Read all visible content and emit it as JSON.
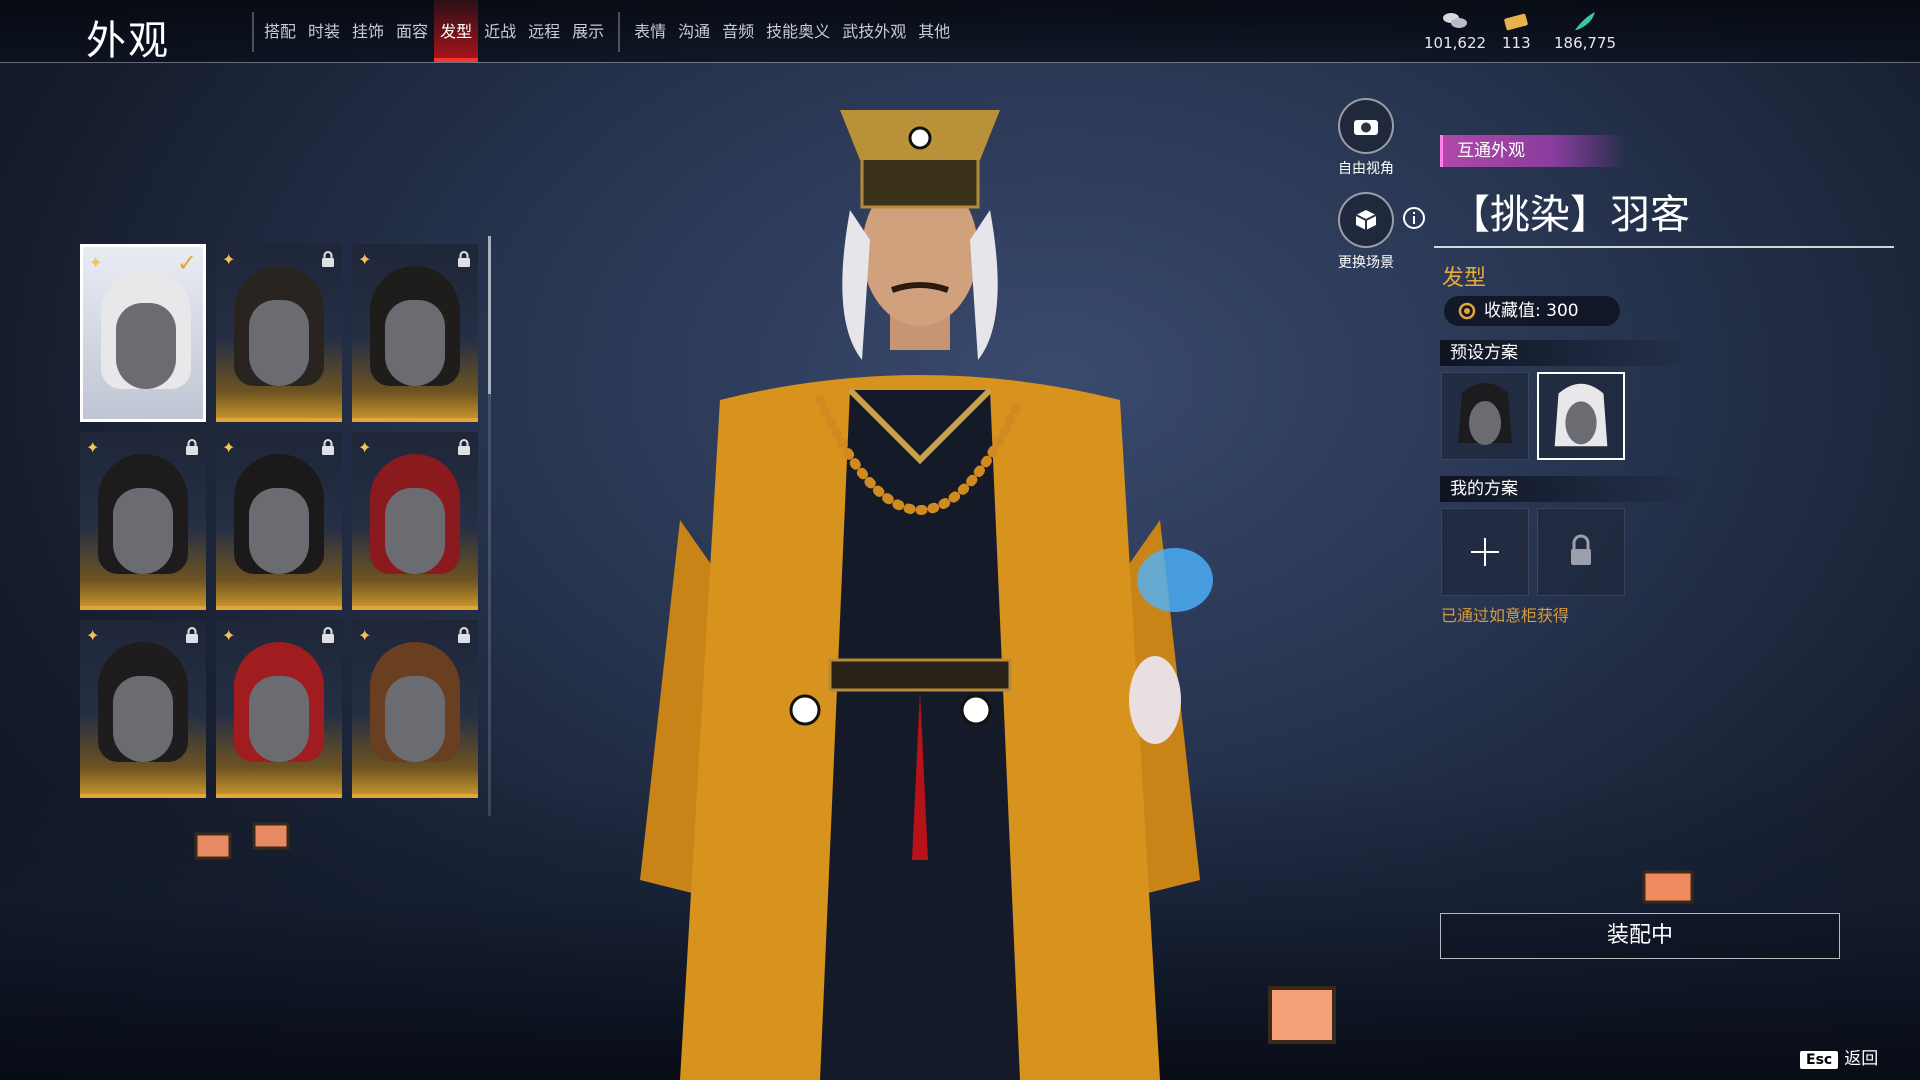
{
  "header": {
    "title": "外观"
  },
  "tabs": [
    {
      "label": "搭配"
    },
    {
      "label": "时装"
    },
    {
      "label": "挂饰"
    },
    {
      "label": "面容"
    },
    {
      "label": "发型",
      "active": true
    },
    {
      "label": "近战"
    },
    {
      "label": "远程"
    },
    {
      "label": "展示"
    },
    {
      "label": "表情"
    },
    {
      "label": "沟通"
    },
    {
      "label": "音频"
    },
    {
      "label": "技能奥义"
    },
    {
      "label": "武技外观"
    },
    {
      "label": "其他"
    }
  ],
  "currencies": [
    {
      "icon": "coin-stack-icon",
      "value": "101,622"
    },
    {
      "icon": "ticket-icon",
      "value": "113"
    },
    {
      "icon": "feather-icon",
      "value": "186,775"
    }
  ],
  "hair_cards": [
    {
      "hair_color": "#e8e8ea",
      "selected": true,
      "locked": false
    },
    {
      "hair_color": "#2a2420",
      "selected": false,
      "locked": true
    },
    {
      "hair_color": "#1f1c1c",
      "selected": false,
      "locked": true
    },
    {
      "hair_color": "#1d1b1b",
      "selected": false,
      "locked": true
    },
    {
      "hair_color": "#1b1919",
      "selected": false,
      "locked": true
    },
    {
      "hair_color": "#8a1a1e",
      "selected": false,
      "locked": true
    },
    {
      "hair_color": "#1e1c1c",
      "selected": false,
      "locked": true
    },
    {
      "hair_color": "#a11c1f",
      "selected": false,
      "locked": true
    },
    {
      "hair_color": "#6a3e20",
      "selected": false,
      "locked": true
    }
  ],
  "side_buttons": {
    "free_view": "自由视角",
    "change_scene": "更换场景"
  },
  "item": {
    "tag": "互通外观",
    "name": "【挑染】羽客",
    "category": "发型",
    "collection": "收藏值: 300"
  },
  "presets": {
    "title": "预设方案"
  },
  "my_plans": {
    "title": "我的方案"
  },
  "obtained": "已通过如意柜获得",
  "equip_button": "装配中",
  "esc": {
    "key": "Esc",
    "label": "返回"
  },
  "colors": {
    "accent_red": "#ff3030",
    "gold": "#e0a63a",
    "robe": "#d8921e"
  }
}
